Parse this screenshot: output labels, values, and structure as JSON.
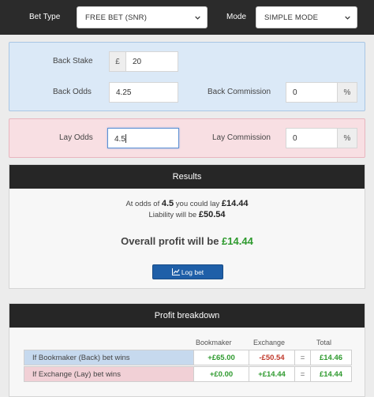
{
  "topbar": {
    "bet_type_label": "Bet Type",
    "bet_type_value": "FREE BET (SNR)",
    "mode_label": "Mode",
    "mode_value": "SIMPLE MODE"
  },
  "back": {
    "stake_label": "Back Stake",
    "currency": "£",
    "stake_value": "20",
    "odds_label": "Back Odds",
    "odds_value": "4.25",
    "commission_label": "Back Commission",
    "commission_value": "0",
    "percent": "%"
  },
  "lay": {
    "odds_label": "Lay Odds",
    "odds_value": "4.5",
    "commission_label": "Lay Commission",
    "commission_value": "0",
    "percent": "%"
  },
  "results": {
    "title": "Results",
    "line1_prefix": "At odds of",
    "line1_odds": "4.5",
    "line1_mid": "you could lay",
    "line1_amount": "£14.44",
    "line2_prefix": "Liability will be",
    "line2_amount": "£50.54",
    "profit_prefix": "Overall profit will be",
    "profit_amount": "£14.44",
    "log_button": "Log bet"
  },
  "breakdown": {
    "title": "Profit breakdown",
    "headers": [
      "Bookmaker",
      "Exchange",
      "Total"
    ],
    "rows": [
      {
        "label": "If Bookmaker (Back) bet wins",
        "bookmaker": "+£65.00",
        "exchange": "-£50.54",
        "eq": "=",
        "total": "£14.46"
      },
      {
        "label": "If Exchange (Lay) bet wins",
        "bookmaker": "+£0.00",
        "exchange": "+£14.44",
        "eq": "=",
        "total": "£14.44"
      }
    ]
  },
  "colors": {
    "topbar": "#2b2b2b",
    "back_panel": "#dbe9f7",
    "lay_panel": "#f8dfe3",
    "positive": "#2e9a2e",
    "negative": "#c0392b",
    "button": "#1f5fa8"
  },
  "icons": {
    "chart": "line-chart-icon",
    "dropdown": "chevron-down-icon"
  }
}
